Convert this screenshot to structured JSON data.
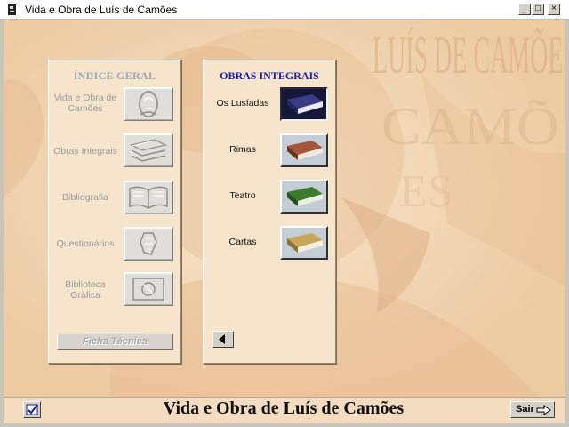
{
  "window": {
    "title": "Vida e Obra de Luís de Camões",
    "controls": {
      "minimize": "_",
      "maximize": "□",
      "close": "×"
    }
  },
  "index_panel": {
    "heading": "ÍNDICE   GERAL",
    "items": [
      {
        "label": "Vida e Obra de Camões",
        "icon": "portrait-icon"
      },
      {
        "label": "Obras Integrais",
        "icon": "books-icon"
      },
      {
        "label": "Bibliografia",
        "icon": "open-book-icon"
      },
      {
        "label": "Questionários",
        "icon": "questionnaire-icon"
      },
      {
        "label": "Biblioteca Gráfica",
        "icon": "graphic-library-icon"
      }
    ],
    "ficha_label": "Ficha Técnica"
  },
  "works_panel": {
    "heading": "OBRAS INTEGRAIS",
    "items": [
      {
        "label": "Os Lusíadas",
        "book_color": "#3b3c86",
        "selected": true
      },
      {
        "label": "Rimas",
        "book_color": "#a4563a",
        "selected": false
      },
      {
        "label": "Teatro",
        "book_color": "#3f7a2c",
        "selected": false
      },
      {
        "label": "Cartas",
        "book_color": "#c8a65a",
        "selected": false
      }
    ],
    "back_icon": "arrow-left-icon"
  },
  "background": {
    "watermark_text": "LUÍS DE CAMÕES"
  },
  "footer": {
    "title": "Vida e Obra de Luís de Camões",
    "exit_label": "Sair",
    "check_icon": "checkmark-icon"
  },
  "colors": {
    "parchment": "#f3d7b5",
    "works_heading": "#1a1aa8",
    "index_heading": "#9ea7b4"
  }
}
